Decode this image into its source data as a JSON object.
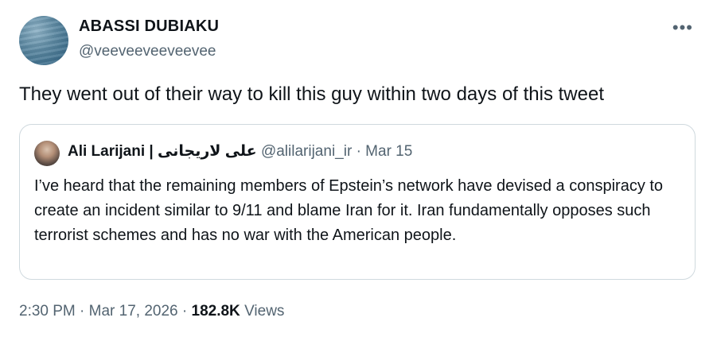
{
  "author": {
    "name": "ABASSI DUBIAKU",
    "handle": "@veeveeveeveevee",
    "more_icon": "more-horizontal-icon"
  },
  "tweet": {
    "text": "They went out of their way to kill this guy within two days of this tweet"
  },
  "quoted": {
    "name": "Ali Larijani | علی لاریجانی",
    "handle": "@alilarijani_ir",
    "separator": "·",
    "date": "Mar 15",
    "text": "I’ve heard that the remaining members of Epstein’s network have devised a conspiracy to create an incident similar to 9/11 and blame Iran for it. Iran fundamentally opposes such terrorist schemes and has no war with the American people."
  },
  "meta": {
    "time": "2:30 PM",
    "sep1": "·",
    "date": "Mar 17, 2026",
    "sep2": "·",
    "views_count": "182.8K",
    "views_label": "Views"
  },
  "colors": {
    "text": "#0f1419",
    "secondary": "#536471",
    "border": "#cfd9de"
  }
}
